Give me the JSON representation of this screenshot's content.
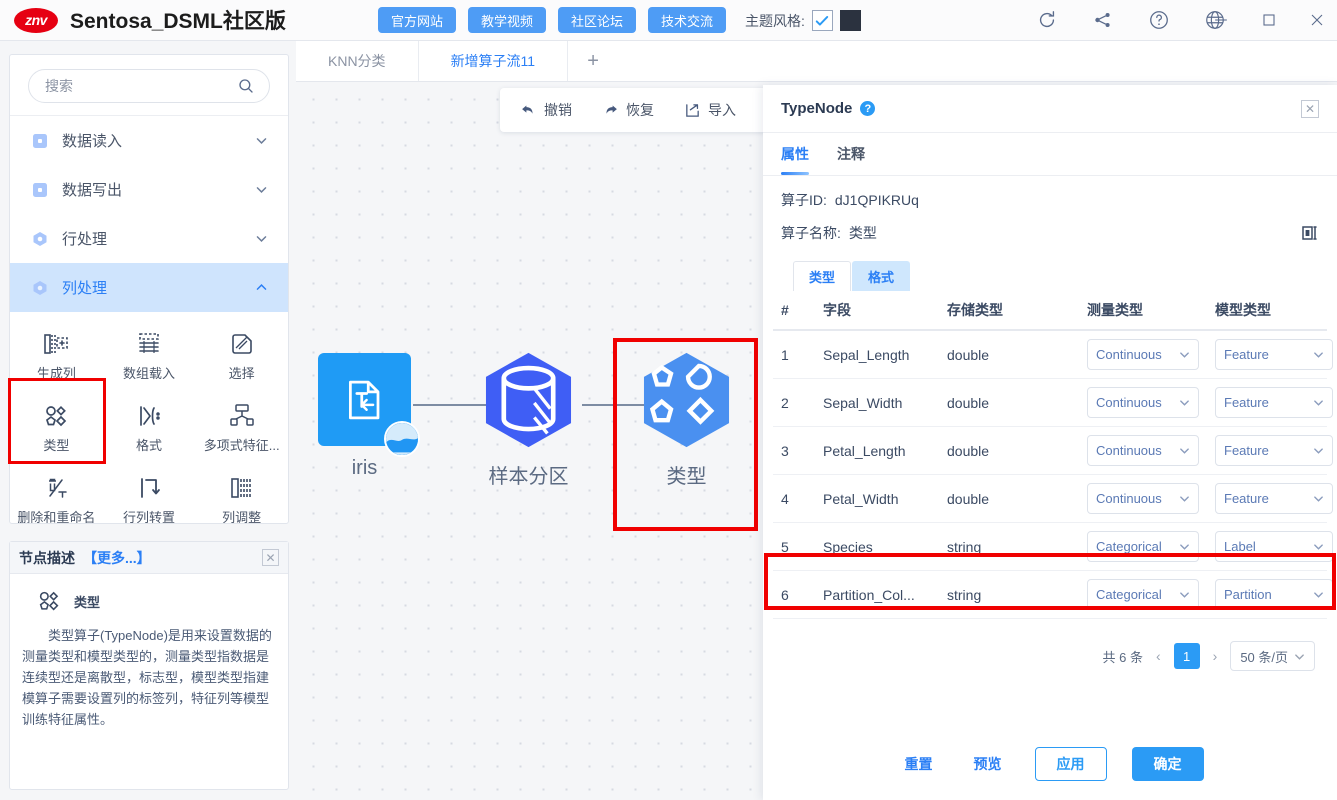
{
  "titlebar": {
    "logo_text": "znv",
    "app_title": "Sentosa_DSML社区版",
    "nav_buttons": [
      {
        "label": "官方网站",
        "name": "official-website-button"
      },
      {
        "label": "教学视频",
        "name": "tutorial-video-button"
      },
      {
        "label": "社区论坛",
        "name": "community-forum-button"
      },
      {
        "label": "技术交流",
        "name": "tech-exchange-button"
      }
    ],
    "theme_label": "主题风格:",
    "theme_checked": true,
    "theme_swatch_color": "#2b323f",
    "tool_icons": [
      "refresh-icon",
      "workflow-icon",
      "help-icon",
      "globe-icon"
    ],
    "window_buttons": [
      "minimize-icon",
      "maximize-icon",
      "close-icon"
    ]
  },
  "sidebar": {
    "search": {
      "placeholder": "搜索",
      "value": ""
    },
    "tree": [
      {
        "label": "数据读入",
        "expanded": false
      },
      {
        "label": "数据写出",
        "expanded": false
      },
      {
        "label": "行处理",
        "expanded": false
      },
      {
        "label": "列处理",
        "expanded": true
      }
    ],
    "operators": [
      {
        "label": "生成列",
        "icon": "generate-column-icon"
      },
      {
        "label": "数组载入",
        "icon": "array-load-icon"
      },
      {
        "label": "选择",
        "icon": "select-icon"
      },
      {
        "label": "类型",
        "icon": "type-icon"
      },
      {
        "label": "格式",
        "icon": "format-icon"
      },
      {
        "label": "多项式特征...",
        "icon": "polynomial-feature-icon"
      },
      {
        "label": "删除和重命名",
        "icon": "delete-rename-icon"
      },
      {
        "label": "行列转置",
        "icon": "transpose-icon"
      },
      {
        "label": "列调整",
        "icon": "column-adjust-icon"
      }
    ]
  },
  "description": {
    "title": "节点描述",
    "more": "【更多...】",
    "node_name": "类型",
    "text": "类型算子(TypeNode)是用来设置数据的测量类型和模型类型的，测量类型指数据是连续型还是离散型，标志型，模型类型指建模算子需要设置列的标签列，特征列等模型训练特征属性。"
  },
  "canvas": {
    "tabs": [
      {
        "label": "KNN分类",
        "active": false
      },
      {
        "label": "新增算子流11",
        "active": true
      }
    ],
    "add_tab": "+",
    "toolbar": [
      {
        "label": "撤销",
        "icon": "undo-icon"
      },
      {
        "label": "恢复",
        "icon": "redo-icon"
      },
      {
        "label": "导入",
        "icon": "import-icon"
      }
    ],
    "nodes": [
      {
        "label": "iris",
        "icon": "data-read-icon"
      },
      {
        "label": "样本分区",
        "icon": "partition-icon"
      },
      {
        "label": "类型",
        "icon": "type-icon",
        "highlighted": true
      }
    ]
  },
  "panel": {
    "title": "TypeNode",
    "help_glyph": "?",
    "close_glyph": "✕",
    "tabs": [
      {
        "label": "属性",
        "active": true
      },
      {
        "label": "注释",
        "active": false
      }
    ],
    "operator_id_label": "算子ID:",
    "operator_id_value": "dJ1QPIKRUq",
    "operator_name_label": "算子名称:",
    "operator_name_value": "类型",
    "segments": [
      {
        "label": "类型",
        "selected": false
      },
      {
        "label": "格式",
        "selected": true
      }
    ],
    "table": {
      "columns": [
        "#",
        "字段",
        "存储类型",
        "测量类型",
        "模型类型"
      ],
      "rows": [
        {
          "idx": "1",
          "field": "Sepal_Length",
          "storage": "double",
          "measure": "Continuous",
          "model": "Feature",
          "highlighted": false
        },
        {
          "idx": "2",
          "field": "Sepal_Width",
          "storage": "double",
          "measure": "Continuous",
          "model": "Feature",
          "highlighted": false
        },
        {
          "idx": "3",
          "field": "Petal_Length",
          "storage": "double",
          "measure": "Continuous",
          "model": "Feature",
          "highlighted": false
        },
        {
          "idx": "4",
          "field": "Petal_Width",
          "storage": "double",
          "measure": "Continuous",
          "model": "Feature",
          "highlighted": false
        },
        {
          "idx": "5",
          "field": "Species",
          "storage": "string",
          "measure": "Categorical",
          "model": "Label",
          "highlighted": true
        },
        {
          "idx": "6",
          "field": "Partition_Col...",
          "storage": "string",
          "measure": "Categorical",
          "model": "Partition",
          "highlighted": false
        }
      ]
    },
    "pagination": {
      "total": "共 6 条",
      "prev": "‹",
      "current": "1",
      "next": "›",
      "page_size": "50 条/页"
    },
    "footer": {
      "reset": "重置",
      "preview": "预览",
      "apply": "应用",
      "confirm": "确定"
    }
  }
}
